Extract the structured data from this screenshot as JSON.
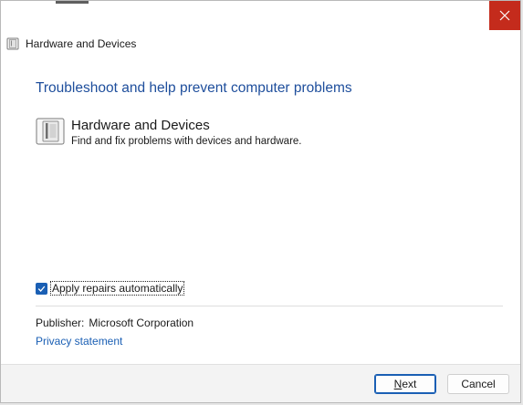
{
  "window": {
    "title": "Hardware and Devices",
    "close_icon": "close-icon",
    "app_icon": "hardware-devices-icon"
  },
  "main": {
    "heading": "Troubleshoot and help prevent computer problems",
    "tool": {
      "icon": "hardware-devices-icon",
      "name": "Hardware and Devices",
      "description": "Find and fix problems with devices and hardware."
    },
    "apply_repairs": {
      "label": "Apply repairs automatically",
      "checked": true
    },
    "publisher": {
      "label": "Publisher:",
      "value": "Microsoft Corporation"
    },
    "privacy_link": "Privacy statement"
  },
  "footer": {
    "next_mnemonic": "N",
    "next_rest": "ext",
    "cancel_label": "Cancel"
  },
  "colors": {
    "accent": "#1a5fb4",
    "heading": "#1e4e9c",
    "close": "#c42b1c"
  }
}
